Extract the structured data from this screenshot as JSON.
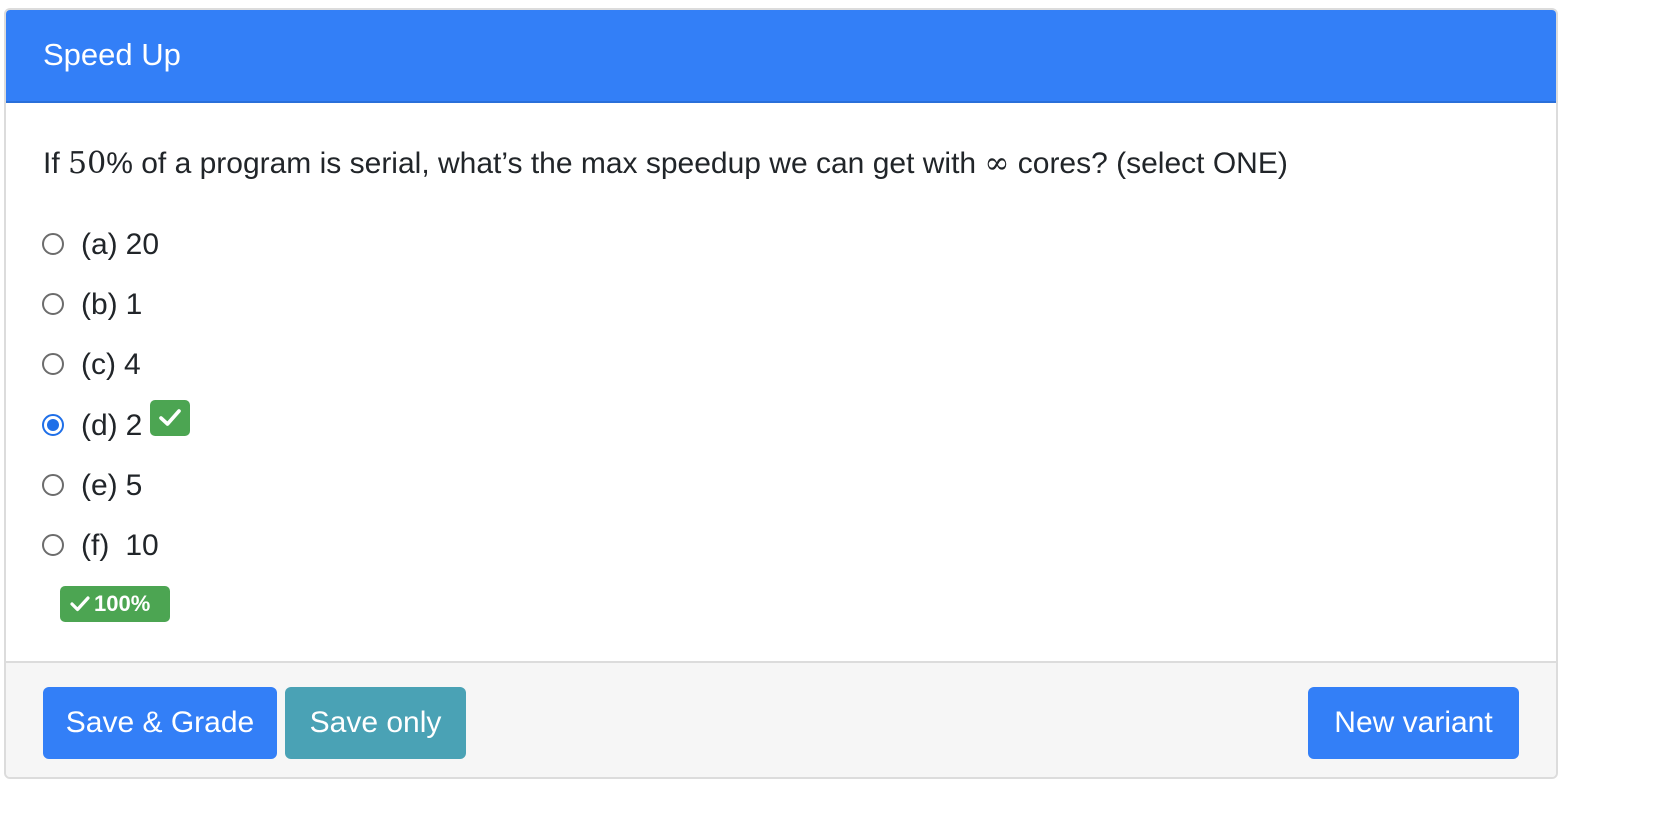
{
  "header": {
    "title": "Speed Up"
  },
  "question": {
    "prefix": "If ",
    "math_number": "50",
    "middle": "% of a program is serial, what’s the max speedup we can get with ",
    "math_symbol": "∞",
    "suffix": " cores? (select ONE)"
  },
  "options": [
    {
      "key": "(a)",
      "value": "20",
      "selected": false
    },
    {
      "key": "(b)",
      "value": "1",
      "selected": false
    },
    {
      "key": "(c)",
      "value": "4",
      "selected": false
    },
    {
      "key": "(d)",
      "value": "2",
      "selected": true,
      "marked_correct": true
    },
    {
      "key": "(e)",
      "value": "5",
      "selected": false
    },
    {
      "key": "(f)",
      "value": "10",
      "selected": false
    }
  ],
  "score_badge": {
    "label": "100%"
  },
  "footer": {
    "save_grade_label": "Save & Grade",
    "save_only_label": "Save only",
    "new_variant_label": "New variant"
  },
  "colors": {
    "primary": "#337ff7",
    "info": "#4aa2b5",
    "success": "#4ca552"
  },
  "icons": {
    "correct": "check-icon",
    "score": "check-icon"
  }
}
